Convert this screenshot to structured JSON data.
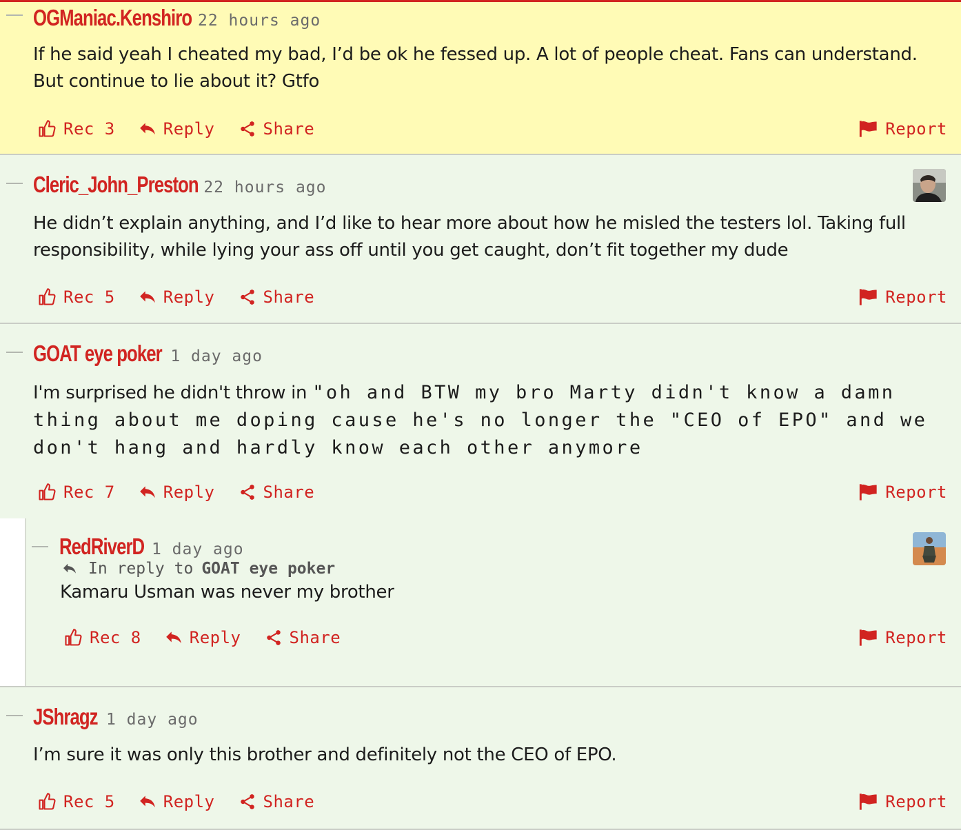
{
  "comments": [
    {
      "author": "OGManiac.Kenshiro",
      "time": "22 hours ago",
      "body": "If he said yeah I cheated my bad, I’d be ok he fessed up. A lot of people cheat. Fans can understand. But continue to lie about it? Gtfo",
      "rec": "Rec 3",
      "reply": "Reply",
      "share": "Share",
      "report": "Report"
    },
    {
      "author": "Cleric_John_Preston",
      "time": "22 hours ago",
      "body": "He didn’t explain anything, and I’d like to hear more about how he misled the testers lol. Taking full responsibility, while lying your ass off until you get caught, don’t fit together my dude",
      "rec": "Rec 5",
      "reply": "Reply",
      "share": "Share",
      "report": "Report"
    },
    {
      "author": "GOAT eye poker",
      "time": "1 day ago",
      "body_lead": "I'm surprised he didn't throw in ",
      "body_rest": "\"oh and BTW my bro Marty didn't know a damn thing about me doping cause he's no longer the \"CEO of EPO\" and we don't hang and hardly know each other anymore",
      "rec": "Rec 7",
      "reply": "Reply",
      "share": "Share",
      "report": "Report"
    },
    {
      "author": "RedRiverD",
      "time": "1 day ago",
      "reply_prefix": "In reply to",
      "reply_to": "GOAT eye poker",
      "body": "Kamaru Usman was never my brother",
      "rec": "Rec 8",
      "reply": "Reply",
      "share": "Share",
      "report": "Report"
    },
    {
      "author": "JShragz",
      "time": "1 day ago",
      "body": "I’m sure it was only this brother and definitely not the CEO of EPO.",
      "rec": "Rec 5",
      "reply": "Reply",
      "share": "Share",
      "report": "Report"
    }
  ],
  "colors": {
    "accent": "#d12421",
    "highlight_bg": "#fffbb6",
    "comment_bg": "#eef7e9"
  }
}
